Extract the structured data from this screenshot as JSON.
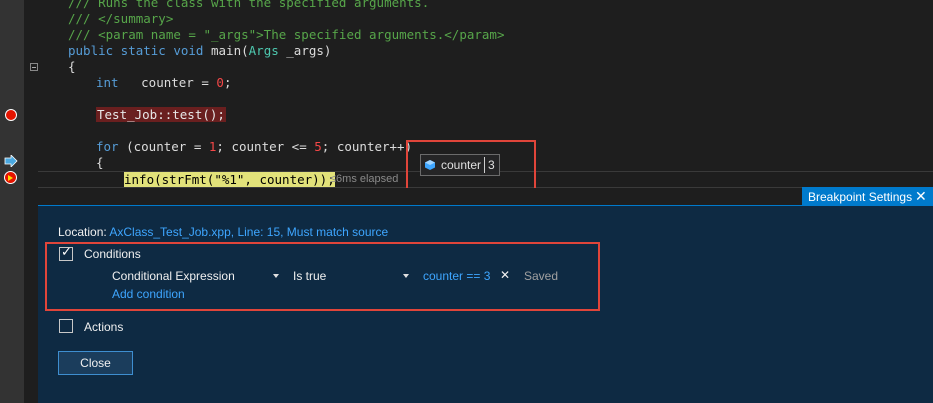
{
  "editor": {
    "lines": {
      "l1": "/// Runs the class with the specified arguments.",
      "l2": "/// </summary>",
      "l3": "/// <param name = \"_args\">The specified arguments.</param>",
      "l4_kw": "public static void",
      "l4_fn": "main(",
      "l4_type": "Args",
      "l4_rest": "_args)",
      "l5": "{",
      "l6_kw": "int",
      "l6_rest": "counter = ",
      "l6_num": "0",
      "l6_end": ";",
      "l7": "Test_Job::test();",
      "l8_kw": "for",
      "l8_a": " (counter = ",
      "l8_n1": "1",
      "l8_b": "; counter <= ",
      "l8_n2": "5",
      "l8_c": "; counter++)",
      "l9": "{",
      "l10_a": "info(strFmt(",
      "l10_s": "\"%1\"",
      "l10_b": ", counter));"
    },
    "elapsed": "≤6ms elapsed"
  },
  "datatip": {
    "name": "counter",
    "value": "3"
  },
  "breakpoint_settings": {
    "tab_label": "Breakpoint Settings",
    "close_x": "✕",
    "location_label": "Location:",
    "location_value": "AxClass_Test_Job.xpp, Line: 15, Must match source",
    "conditions_label": "Conditions",
    "conditions_checked": true,
    "condition_type": "Conditional Expression",
    "condition_op": "Is true",
    "condition_expr": "counter == 3",
    "remove_x": "✕",
    "saved": "Saved",
    "add_condition": "Add condition",
    "actions_label": "Actions",
    "actions_checked": false,
    "close_button": "Close"
  },
  "colors": {
    "accent": "#007acc",
    "breakpoint": "#e51400",
    "highlight": "#e0453a"
  }
}
